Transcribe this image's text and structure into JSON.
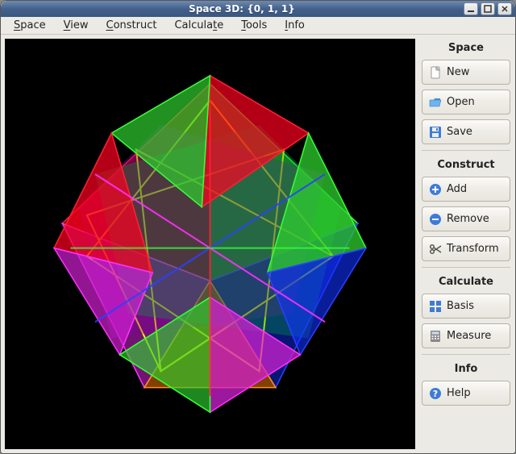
{
  "window": {
    "title": "Space 3D: {0, 1, 1}"
  },
  "menubar": {
    "items": [
      {
        "accel": "S",
        "rest": "pace"
      },
      {
        "accel": "V",
        "rest": "iew"
      },
      {
        "accel": "C",
        "rest": "onstruct"
      },
      {
        "accel": "C",
        "rest": "alculate",
        "pre": ""
      },
      {
        "accel": "T",
        "rest": "ools"
      },
      {
        "accel": "I",
        "rest": "nfo"
      }
    ],
    "labels": [
      "Space",
      "View",
      "Construct",
      "Calculate",
      "Tools",
      "Info"
    ]
  },
  "sidebar": {
    "sections": {
      "space": {
        "title": "Space",
        "new_label": "New",
        "open_label": "Open",
        "save_label": "Save"
      },
      "construct": {
        "title": "Construct",
        "add_label": "Add",
        "remove_label": "Remove",
        "transform_label": "Transform"
      },
      "calculate": {
        "title": "Calculate",
        "basis_label": "Basis",
        "measure_label": "Measure"
      },
      "info": {
        "title": "Info",
        "help_label": "Help"
      }
    }
  },
  "colors": {
    "accent_blue": "#3e7bd6",
    "green": "#2fcf2f",
    "red": "#ff0020",
    "magenta": "#d020d0",
    "yellow": "#ffee00",
    "blue3d": "#1030ff",
    "cyan": "#00e0c0"
  }
}
